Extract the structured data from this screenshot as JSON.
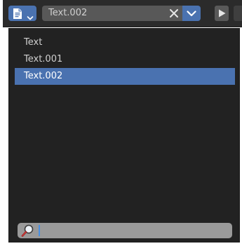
{
  "header": {
    "editor_icon": "text-document-icon",
    "datablock_name": "Text.002",
    "clear_icon": "close-icon",
    "browse_icon": "chevron-down-icon",
    "run_icon": "play-icon"
  },
  "dropdown": {
    "items": [
      {
        "label": "Text",
        "selected": false
      },
      {
        "label": "Text.001",
        "selected": false
      },
      {
        "label": "Text.002",
        "selected": true
      }
    ],
    "search": {
      "icon": "magnifier-icon",
      "value": "",
      "placeholder": ""
    }
  },
  "colors": {
    "accent": "#4a72b0",
    "background": "#222222",
    "header": "#2b2b2b",
    "text": "#d0d0d0"
  }
}
